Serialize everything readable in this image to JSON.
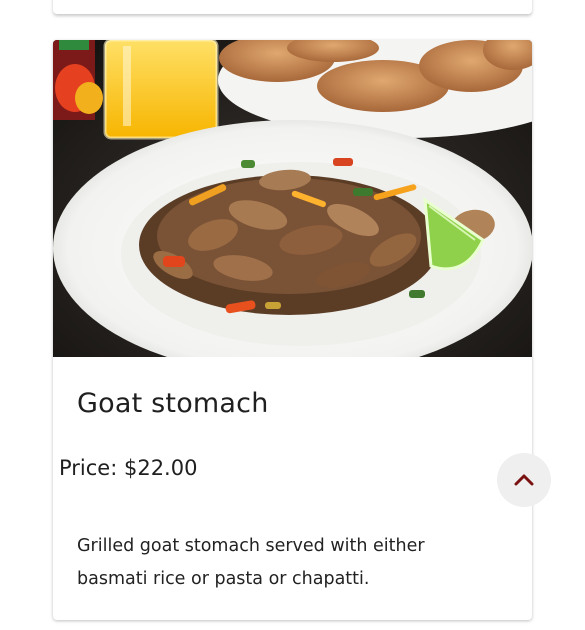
{
  "item": {
    "title": "Goat stomach",
    "price_text": "Price: $22.00",
    "description": "Grilled goat stomach served with either basmati rice or pasta or chapatti."
  },
  "icons": {
    "image": "dish-photo",
    "collapse": "chevron-up-icon"
  },
  "colors": {
    "accent": "#7a1212",
    "button_bg": "#efefef",
    "text": "#1f1f1f"
  }
}
